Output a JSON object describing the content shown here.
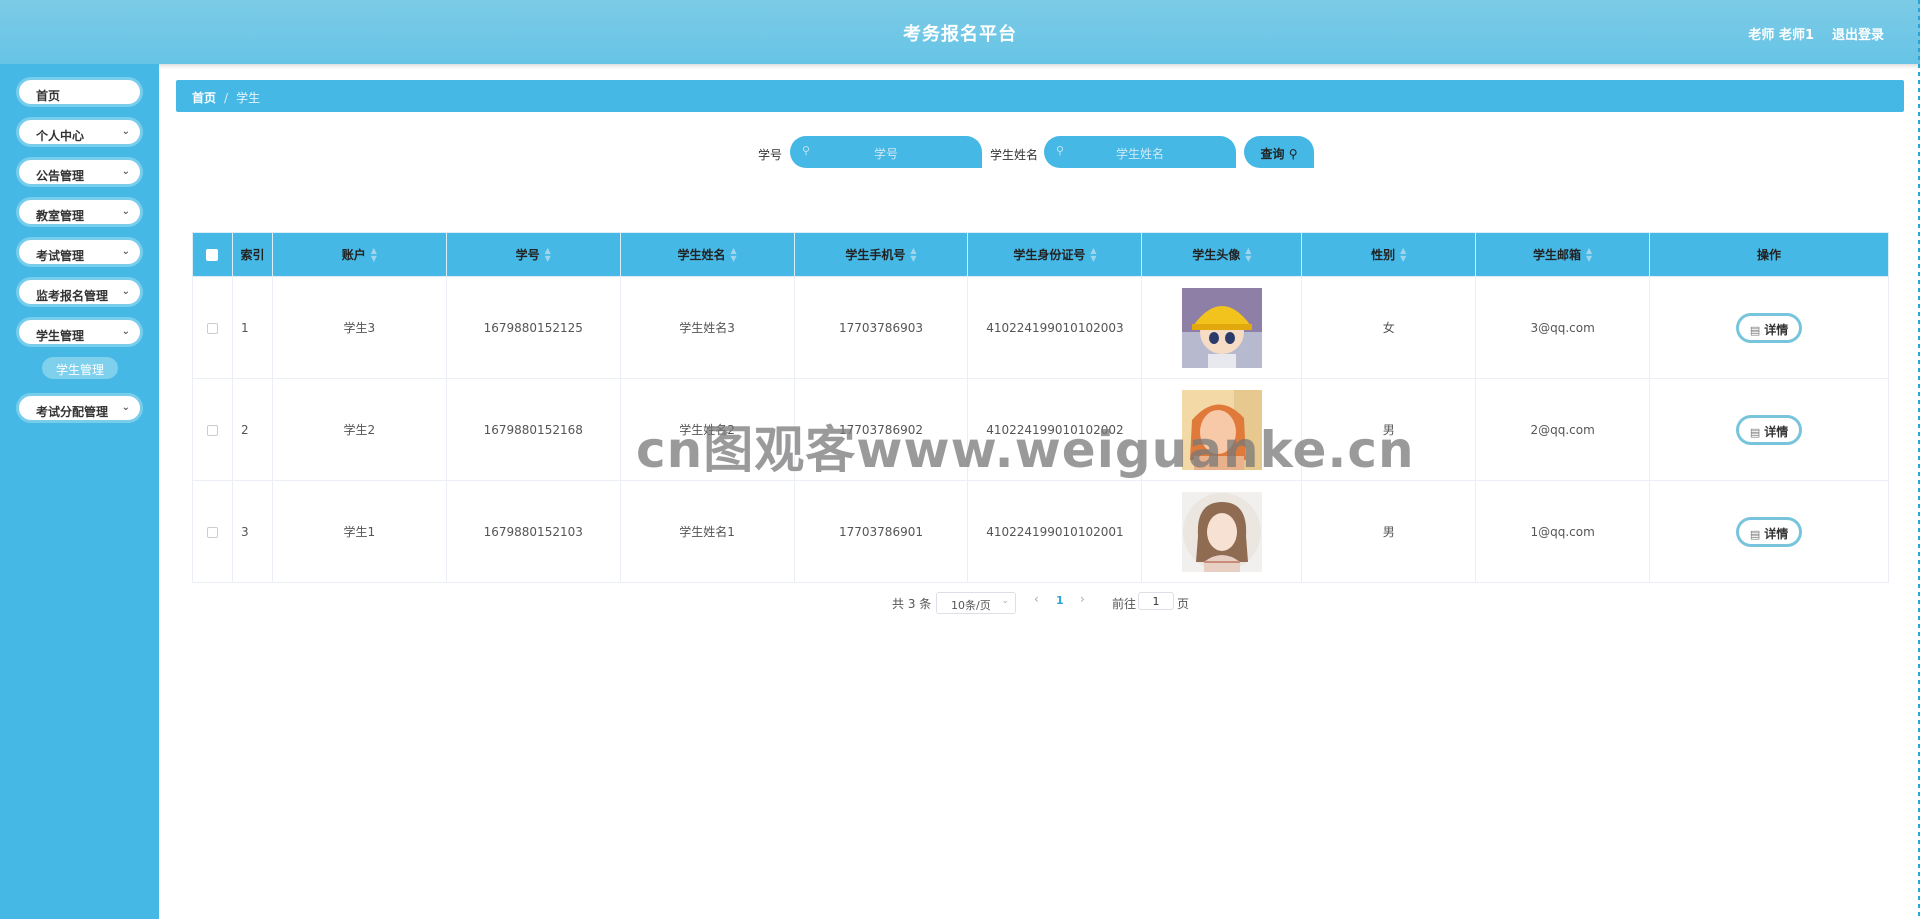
{
  "header": {
    "title": "考务报名平台",
    "user": "老师 老师1",
    "logout": "退出登录"
  },
  "sidebar": {
    "items": [
      {
        "label": "首页",
        "chevron": false
      },
      {
        "label": "个人中心",
        "chevron": true
      },
      {
        "label": "公告管理",
        "chevron": true
      },
      {
        "label": "教室管理",
        "chevron": true
      },
      {
        "label": "考试管理",
        "chevron": true
      },
      {
        "label": "监考报名管理",
        "chevron": true
      },
      {
        "label": "学生管理",
        "chevron": true
      },
      {
        "label": "考试分配管理",
        "chevron": true
      }
    ],
    "sub_item": "学生管理"
  },
  "breadcrumb": {
    "home": "首页",
    "separator": "/",
    "current": "学生"
  },
  "search": {
    "student_no_label": "学号",
    "student_no_placeholder": "学号",
    "student_name_label": "学生姓名",
    "student_name_placeholder": "学生姓名",
    "query_button": "查询"
  },
  "table": {
    "headers": [
      "索引",
      "账户",
      "学号",
      "学生姓名",
      "学生手机号",
      "学生身份证号",
      "学生头像",
      "性别",
      "学生邮箱",
      "操作"
    ],
    "rows": [
      {
        "index": "1",
        "account": "学生3",
        "student_no": "1679880152125",
        "name": "学生姓名3",
        "phone": "17703786903",
        "id_card": "410224199010102003",
        "avatar": "cartoon-avatar",
        "gender": "女",
        "email": "3@qq.com",
        "action": "详情"
      },
      {
        "index": "2",
        "account": "学生2",
        "student_no": "1679880152168",
        "name": "学生姓名2",
        "phone": "17703786902",
        "id_card": "410224199010102002",
        "avatar": "photo-avatar",
        "gender": "男",
        "email": "2@qq.com",
        "action": "详情"
      },
      {
        "index": "3",
        "account": "学生1",
        "student_no": "1679880152103",
        "name": "学生姓名1",
        "phone": "17703786901",
        "id_card": "410224199010102001",
        "avatar": "illustration-avatar",
        "gender": "男",
        "email": "1@qq.com",
        "action": "详情"
      }
    ]
  },
  "pagination": {
    "total": "共 3 条",
    "page_size": "10条/页",
    "prev": "‹",
    "current_page": "1",
    "next": "›",
    "goto_label": "前往",
    "goto_value": "1",
    "page_unit": "页"
  },
  "watermark": "cn图观客www.weiguanke.cn",
  "colors": {
    "primary": "#45b8e6",
    "header": "#6fc6e6",
    "border": "#78cdea"
  }
}
